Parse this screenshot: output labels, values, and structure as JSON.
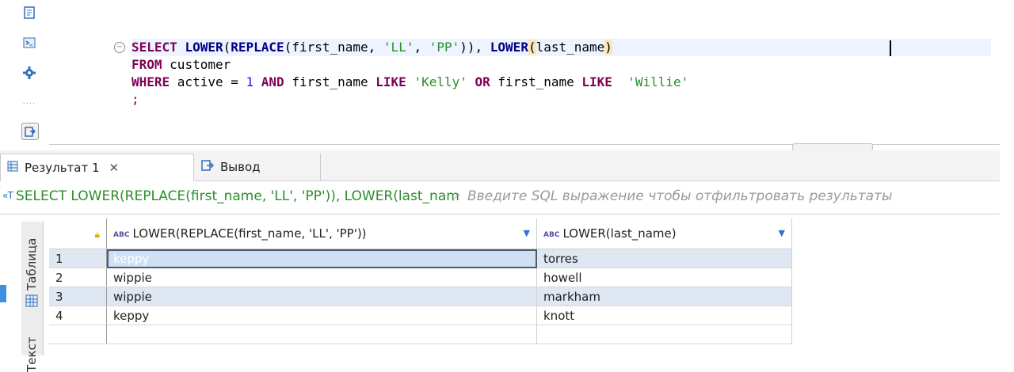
{
  "editor": {
    "lines": [
      {
        "parts": [
          {
            "t": "SELECT ",
            "c": "kw"
          },
          {
            "t": "LOWER",
            "c": "fn"
          },
          {
            "t": "(",
            "c": ""
          },
          {
            "t": "REPLACE",
            "c": "fn"
          },
          {
            "t": "(first_name, ",
            "c": ""
          },
          {
            "t": "'LL'",
            "c": "str"
          },
          {
            "t": ", ",
            "c": ""
          },
          {
            "t": "'PP'",
            "c": "str"
          },
          {
            "t": ")), ",
            "c": ""
          },
          {
            "t": "LOWER",
            "c": "fn"
          },
          {
            "t": "(",
            "c": "hl"
          },
          {
            "t": "last_name",
            "c": ""
          },
          {
            "t": ")",
            "c": "hl"
          }
        ]
      },
      {
        "parts": [
          {
            "t": "FROM ",
            "c": "kw"
          },
          {
            "t": "customer",
            "c": ""
          }
        ]
      },
      {
        "parts": [
          {
            "t": "WHERE ",
            "c": "kw"
          },
          {
            "t": "active = ",
            "c": ""
          },
          {
            "t": "1",
            "c": "num"
          },
          {
            "t": " AND ",
            "c": "kw"
          },
          {
            "t": "first_name ",
            "c": ""
          },
          {
            "t": "LIKE ",
            "c": "kw"
          },
          {
            "t": "'Kelly'",
            "c": "str"
          },
          {
            "t": " OR ",
            "c": "kw"
          },
          {
            "t": "first_name ",
            "c": ""
          },
          {
            "t": "LIKE",
            "c": "kw"
          },
          {
            "t": "  ",
            "c": ""
          },
          {
            "t": "'Willie'",
            "c": "str"
          }
        ]
      },
      {
        "parts": [
          {
            "t": ";",
            "c": "punct"
          }
        ]
      }
    ]
  },
  "tabs": {
    "results_label": "Результат 1",
    "close_glyph": "✕",
    "output_label": "Вывод"
  },
  "filter": {
    "query_prefix": "«T",
    "query": "SELECT LOWER(REPLACE(first_name, 'LL', 'PP')), LOWER(last_name)",
    "placeholder": "Введите SQL выражение чтобы отфильтровать результаты"
  },
  "grid": {
    "badge": "ABC",
    "columns": [
      "LOWER(REPLACE(first_name, 'LL', 'PP'))",
      "LOWER(last_name)"
    ],
    "rows": [
      {
        "n": "1",
        "a": "keppy",
        "b": "torres"
      },
      {
        "n": "2",
        "a": "wippie",
        "b": "howell"
      },
      {
        "n": "3",
        "a": "wippie",
        "b": "markham"
      },
      {
        "n": "4",
        "a": "keppy",
        "b": "knott"
      }
    ]
  },
  "side_tabs": {
    "table_label": "Таблица",
    "text_label": "Текст"
  },
  "colors": {
    "keyword": "#7f0055",
    "string": "#2a8e2a",
    "number": "#1a1aff",
    "selection": "#dfe7f3"
  }
}
